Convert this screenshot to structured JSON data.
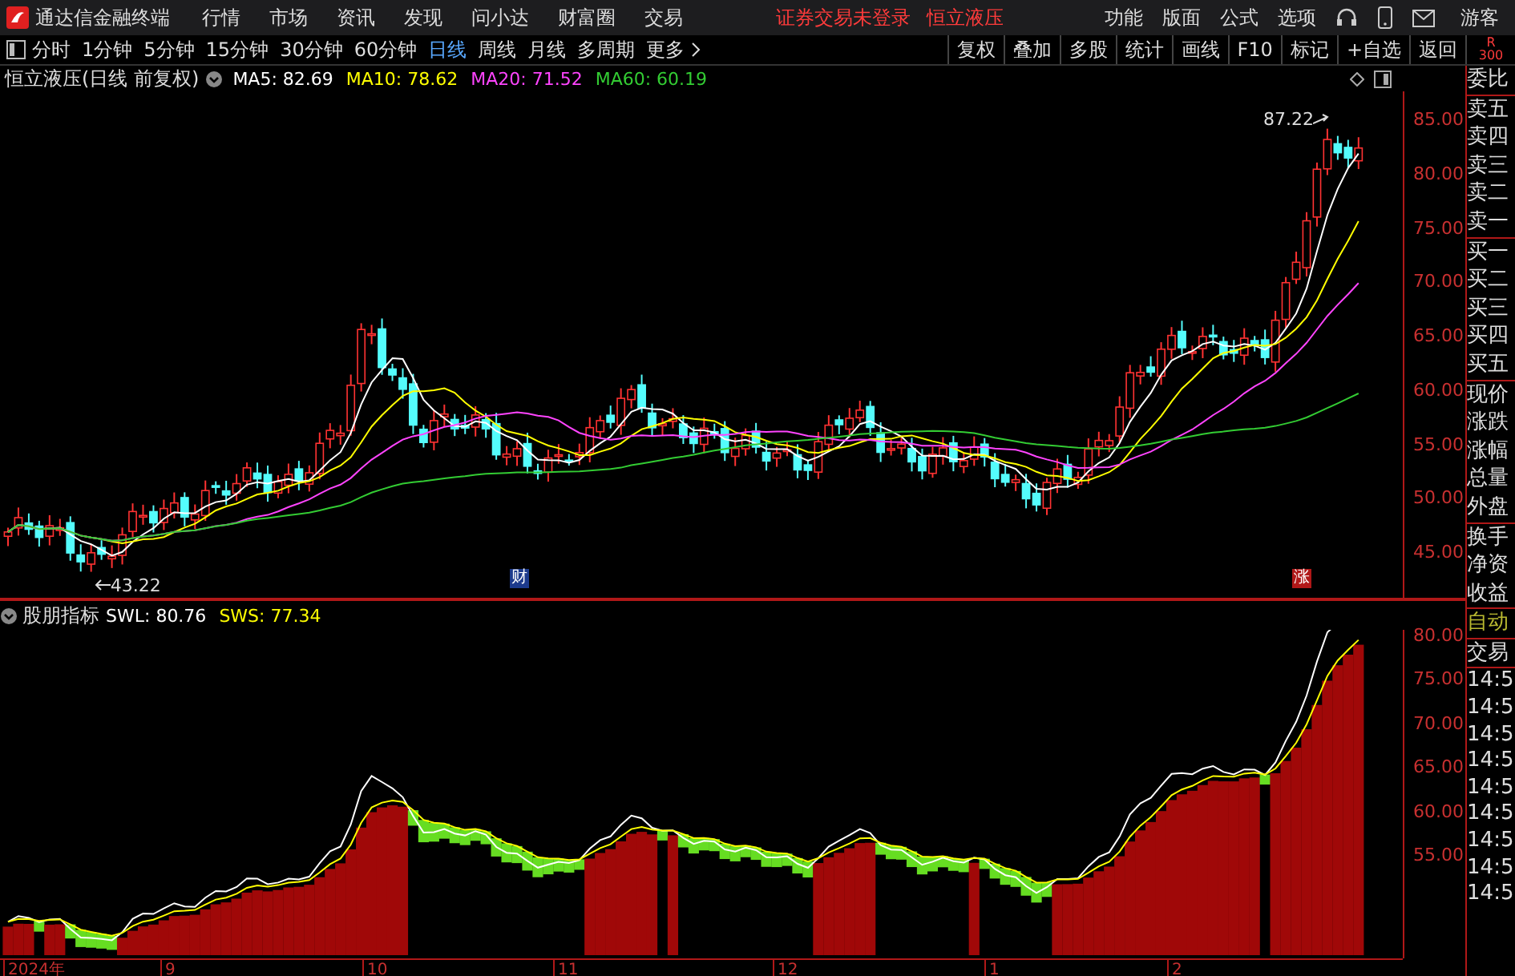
{
  "menu_bar": {
    "app_title": "通达信金融终端",
    "menus": [
      "行情",
      "市场",
      "资讯",
      "发现",
      "问小达",
      "财富圈",
      "交易"
    ],
    "notices": [
      "证券交易未登录",
      "恒立液压"
    ],
    "right_menus": [
      "功能",
      "版面",
      "公式",
      "选项"
    ],
    "user": "游客"
  },
  "toolbar": {
    "periods": [
      {
        "label": "分时",
        "selected": false
      },
      {
        "label": "1分钟",
        "selected": false
      },
      {
        "label": "5分钟",
        "selected": false
      },
      {
        "label": "15分钟",
        "selected": false
      },
      {
        "label": "30分钟",
        "selected": false
      },
      {
        "label": "60分钟",
        "selected": false
      },
      {
        "label": "日线",
        "selected": true
      },
      {
        "label": "周线",
        "selected": false
      },
      {
        "label": "月线",
        "selected": false
      },
      {
        "label": "多周期",
        "selected": false
      },
      {
        "label": "更多",
        "selected": false
      }
    ],
    "actions": [
      "复权",
      "叠加",
      "多股",
      "统计",
      "画线",
      "F10",
      "标记",
      "+自选",
      "返回"
    ],
    "corner": [
      "R",
      "300"
    ]
  },
  "main_chart": {
    "title": "恒立液压(日线 前复权)",
    "indicators": [
      {
        "text": "MA5: 82.69",
        "color": "#ffffff"
      },
      {
        "text": "MA10: 78.62",
        "color": "#ffff00"
      },
      {
        "text": "MA20: 71.52",
        "color": "#ff44ff"
      },
      {
        "text": "MA60: 60.19",
        "color": "#33cc33"
      }
    ],
    "annotations": [
      {
        "text": "87.22",
        "kind": "high"
      },
      {
        "text": "43.22",
        "kind": "low"
      },
      {
        "text": "财",
        "kind": "news"
      },
      {
        "text": "涨",
        "kind": "limit"
      }
    ],
    "price_ticks": [
      "85.00",
      "80.00",
      "75.00",
      "70.00",
      "65.00",
      "60.00",
      "55.00",
      "50.00",
      "45.00"
    ]
  },
  "indicator_panel": {
    "title": "股朋指标",
    "lines": [
      {
        "text": "SWL: 80.76",
        "color": "#ffffff"
      },
      {
        "text": "SWS: 77.34",
        "color": "#ffff00"
      }
    ],
    "value_ticks": [
      "80.00",
      "75.00",
      "70.00",
      "65.00",
      "60.00",
      "55.00"
    ]
  },
  "date_axis": [
    "2024年",
    "9",
    "10",
    "11",
    "12",
    "1",
    "2"
  ],
  "side_panel": {
    "quote_labels": [
      "委比",
      "卖五",
      "卖四",
      "卖三",
      "卖二",
      "卖一",
      "买一",
      "买二",
      "买三",
      "买四",
      "买五",
      "现价",
      "涨跌",
      "涨幅",
      "总量",
      "外盘",
      "换手",
      "净资",
      "收益"
    ],
    "trade_mode": "自动",
    "trade_header": "交易",
    "trade_times": [
      "14:5",
      "14:5",
      "14:5",
      "14:5",
      "14:5",
      "14:5",
      "14:5",
      "14:5",
      "14:5"
    ]
  }
}
